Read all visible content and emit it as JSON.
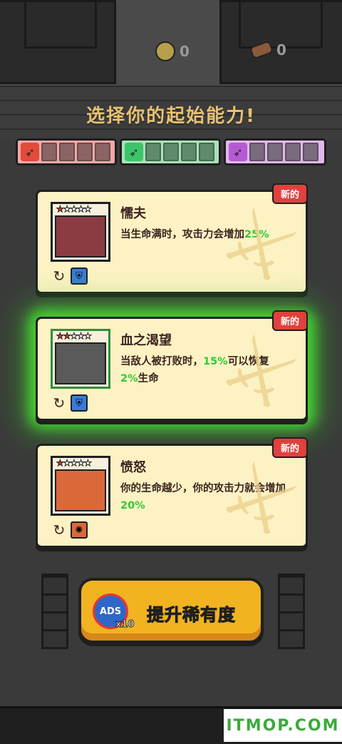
{
  "resources": {
    "coins": "0",
    "wood": "0"
  },
  "title": "选择你的起始能力!",
  "categories": [
    {
      "name": "attack",
      "color": "#e24a3a"
    },
    {
      "name": "defense",
      "color": "#3cc46a"
    },
    {
      "name": "magic",
      "color": "#b65ad4"
    }
  ],
  "cards": [
    {
      "badge": "新的",
      "name": "懦夫",
      "stars": 1,
      "max_stars": 5,
      "desc_parts": [
        "当生命满时，攻击力会增加",
        "25%"
      ],
      "selected": false
    },
    {
      "badge": "新的",
      "name": "血之渴望",
      "stars": 2,
      "max_stars": 5,
      "desc_parts": [
        "当敌人被打败时，",
        "15%",
        "可以恢复",
        "2%",
        "生命"
      ],
      "selected": true
    },
    {
      "badge": "新的",
      "name": "愤怒",
      "stars": 1,
      "max_stars": 5,
      "desc_parts": [
        "你的生命越少，你的攻击力就会增加",
        "20%"
      ],
      "selected": false
    }
  ],
  "upgrade_button": {
    "ads_label": "ADS",
    "ads_count": "x10",
    "label": "提升稀有度"
  },
  "watermark": "ITMOP.COM"
}
